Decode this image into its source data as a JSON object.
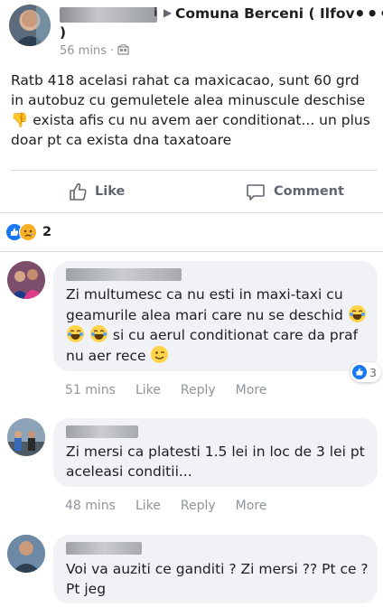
{
  "post": {
    "author_suffix": "i",
    "group_name_line1": "Comuna Berceni ( Ilfov",
    "group_name_line2": ")",
    "timestamp": "56 mins",
    "privacy_separator": "·",
    "text": "Ratb 418 acelasi rahat ca maxicacao, sunt 60 grd in autobuz cu gemuletele alea minuscule deschise 👎 exista afis cu nu avem aer conditionat... un plus doar pt ca exista dna taxatoare",
    "more_label": "..."
  },
  "actions": {
    "like_label": "Like",
    "comment_label": "Comment"
  },
  "reactions": {
    "count": "2",
    "types": [
      "like-icon",
      "sad-icon"
    ]
  },
  "comments": [
    {
      "text": "Zi multumesc ca nu esti in maxi-taxi cu geamurile alea mari care nu se deschid 😂 😂 😂 si cu aerul conditionat care da praf nu aer rece 😉",
      "reaction_count": "3",
      "time": "51 mins",
      "like": "Like",
      "reply": "Reply",
      "more": "More"
    },
    {
      "text": "Zi mersi ca platesti 1.5 lei in loc de 3 lei pt aceleasi conditii...",
      "time": "48 mins",
      "like": "Like",
      "reply": "Reply",
      "more": "More"
    },
    {
      "text": "Voi va auziti ce ganditi ? Zi mersi ?? Pt ce ? Pt jeg"
    }
  ],
  "colors": {
    "blue": "#1877f2",
    "gray_text": "#90949c",
    "bubble_bg": "#f0f2f5",
    "emoji": "#ffd44a"
  }
}
